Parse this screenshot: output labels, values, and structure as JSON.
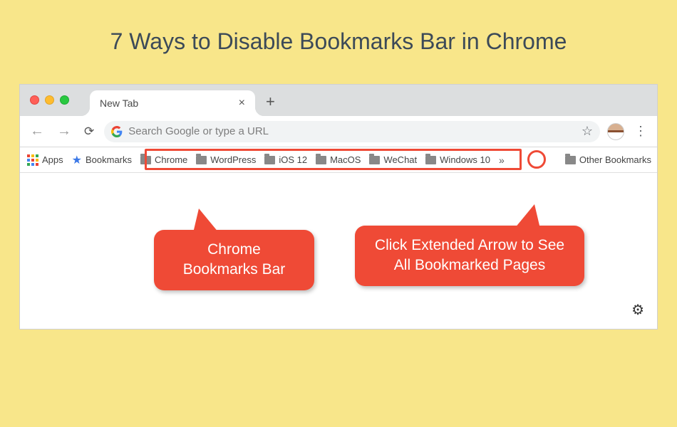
{
  "title": "7 Ways to Disable Bookmarks Bar in Chrome",
  "tab": {
    "label": "New Tab"
  },
  "omnibox": {
    "placeholder": "Search Google or type a URL"
  },
  "bookmarks": {
    "apps_label": "Apps",
    "bookmarks_label": "Bookmarks",
    "folders": [
      "Chrome",
      "WordPress",
      "iOS 12",
      "MacOS",
      "WeChat",
      "Windows 10"
    ],
    "overflow_glyph": "»",
    "other_label": "Other Bookmarks"
  },
  "callouts": {
    "bar": "Chrome Bookmarks Bar",
    "arrow": "Click Extended Arrow to See All Bookmarked Pages"
  },
  "colors": {
    "accent": "#ef4a36",
    "bg": "#f8e68a"
  }
}
